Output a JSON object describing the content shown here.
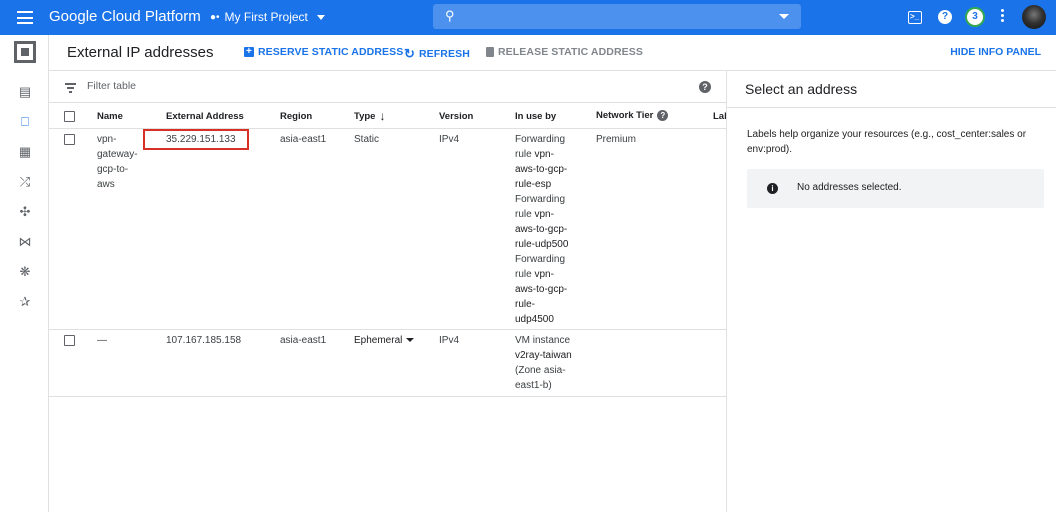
{
  "topbar": {
    "brand": "Google Cloud Platform",
    "project": "My First Project",
    "notifications": "3",
    "accent": "#1a73e8"
  },
  "leftnav": {
    "items": [
      "storage-icon",
      "external-ip-icon",
      "dashboard-icon",
      "routes-icon",
      "network-services-icon",
      "interconnect-icon",
      "vpn-icon",
      "waveform-icon"
    ]
  },
  "header": {
    "title": "External IP addresses",
    "reserve": "RESERVE STATIC ADDRESS",
    "refresh": "REFRESH",
    "release": "RELEASE STATIC ADDRESS",
    "hide_info": "HIDE INFO PANEL"
  },
  "filter": {
    "placeholder": "Filter table"
  },
  "table": {
    "headers": {
      "name": "Name",
      "external_address": "External Address",
      "region": "Region",
      "type": "Type",
      "version": "Version",
      "in_use_by": "In use by",
      "network_tier": "Network Tier",
      "labels": "Lab"
    },
    "rows": [
      {
        "name": [
          "vpn-",
          "gateway-",
          "gcp-to-",
          "aws"
        ],
        "external_address": "35.229.151.133",
        "region": "asia-east1",
        "type": "Static",
        "version": "IPv4",
        "in_use_by": [
          [
            "Forwarding",
            false
          ],
          [
            "rule ",
            false,
            "vpn-"
          ],
          [
            "aws-to-gcp-",
            true
          ],
          [
            "rule-esp",
            true
          ],
          [
            "Forwarding",
            false
          ],
          [
            "rule ",
            false,
            "vpn-"
          ],
          [
            "aws-to-gcp-",
            true
          ],
          [
            "rule-udp500",
            true
          ],
          [
            "Forwarding",
            false
          ],
          [
            "rule ",
            false,
            "vpn-"
          ],
          [
            "aws-to-gcp-",
            true
          ],
          [
            "rule-",
            true
          ],
          [
            "udp4500",
            true
          ]
        ],
        "network_tier": "Premium"
      },
      {
        "name": [
          "—"
        ],
        "external_address": "107.167.185.158",
        "region": "asia-east1",
        "type": "Ephemeral",
        "version": "IPv4",
        "in_use_by": [
          [
            "VM instance",
            false
          ],
          [
            "v2ray-taiwan",
            true
          ],
          [
            "(Zone asia-",
            false
          ],
          [
            "east1-b)",
            false
          ]
        ],
        "network_tier": ""
      }
    ]
  },
  "info_panel": {
    "title": "Select an address",
    "description": "Labels help organize your resources (e.g., cost_center:sales or env:prod).",
    "empty": "No addresses selected."
  }
}
